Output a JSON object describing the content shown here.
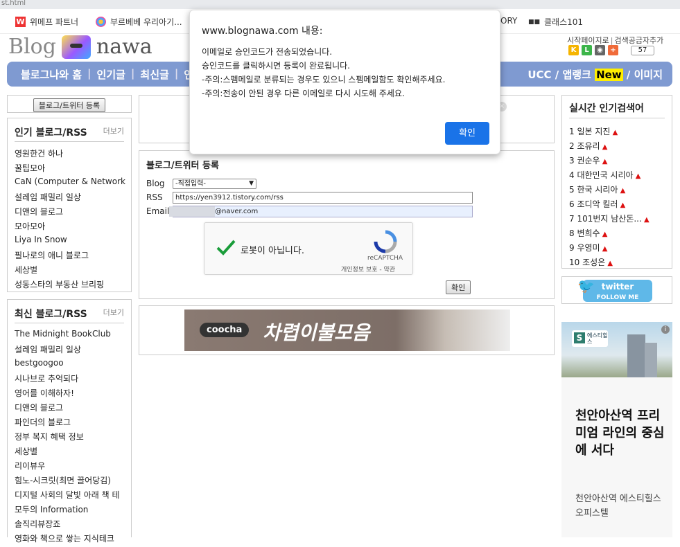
{
  "browser": {
    "url_fragment": "st.html"
  },
  "bookmarks": {
    "items": [
      {
        "label": "위메프 파트너"
      },
      {
        "label": "부르베베 우리아기..."
      },
      {
        "label": "ORY"
      },
      {
        "label": "클래스101"
      }
    ]
  },
  "site": {
    "logo_left": "Blog",
    "logo_right": "nawa",
    "toplinks": [
      "시작페이지로",
      "검색공급자추가"
    ],
    "count": "57"
  },
  "nav": {
    "left": [
      "블로그나와 홈",
      "인기글",
      "최신글",
      "인"
    ],
    "right_pre": "UCC / 앱랭크 ",
    "right_new": "New",
    "right_post": " / 이미지"
  },
  "sidebar": {
    "register_button": "블로그/트위터 등록",
    "popular": {
      "title": "인기 블로그/RSS",
      "more": "더보기",
      "items": [
        "영원한건 하나",
        "꿀팁모아",
        "CaN (Computer & Network) T",
        "설레임 패밀리 일상",
        "디앤의 블로그",
        "모아모아",
        "Liya In Snow",
        "필나로의 애니 블로그",
        "세상벌",
        "성동스타의 부동산 브리핑"
      ]
    },
    "latest": {
      "title": "최신 블로그/RSS",
      "more": "더보기",
      "items": [
        "The Midnight BookClub",
        "설레임 패밀리 일상",
        "bestgoogoo",
        "시나브로 추억되다",
        "영어를 이해하자!",
        "디앤의 블로그",
        "파인더의 블로그",
        "정부 복지 혜택 정보",
        "세상별",
        "리이뷰우",
        "힘노-시크릿(최면 끌어당김)",
        "디지털 사회의 달빛 아래 책 테",
        "모두의 Information",
        "솔직리뷰장죠",
        "영화와 책으로 쌓는 지식테크"
      ]
    }
  },
  "register": {
    "title": "블로그/트위터 등록",
    "blog_label": "Blog",
    "blog_select": "-직접입력-",
    "rss_label": "RSS",
    "rss_value": "https://yen3912.tistory.com/rss",
    "email_label": "Email",
    "email_value": "@naver.com",
    "captcha_text": "로봇이 아닙니다.",
    "captcha_brand": "reCAPTCHA",
    "captcha_links": "개인정보 보호 - 약관",
    "submit": "확인"
  },
  "banner": {
    "brand": "coocha",
    "headline": "차렵이불모음"
  },
  "trending": {
    "title": "실시간 인기검색어",
    "items": [
      "1 일본 지진",
      "2 조유리",
      "3 권순우",
      "4 대한민국 시리아",
      "5 한국 시리아",
      "6 조디악 킬러",
      "7 101번지 남산돈...",
      "8 변희수",
      "9 우영미",
      "10 조성은"
    ]
  },
  "twitter": {
    "line1": "twitter",
    "line2": "FOLLOW ME"
  },
  "ad": {
    "sign": "에스티힐스",
    "title": "천안아산역 프리미엄 라인의 중심에 서다",
    "sub": "천안아산역 에스티힐스 오피스텔"
  },
  "dialog": {
    "title": "www.blognawa.com 내용:",
    "lines": [
      "이메일로 승인코드가 전송되었습니다.",
      "승인코드를 클릭하시면 등록이 완료됩니다.",
      "-주의:스펨메일로 분류되는 경우도 있으니 스펨메일함도 확인해주세요.",
      "-주의:전송이 안된 경우 다른 이메일로 다시 시도해 주세요."
    ],
    "ok": "확인"
  },
  "colors": {
    "nav": "#7f9ad1",
    "ok_button": "#1a73e8",
    "new_badge": "#ffee00",
    "trend_up": "#dd1111"
  }
}
